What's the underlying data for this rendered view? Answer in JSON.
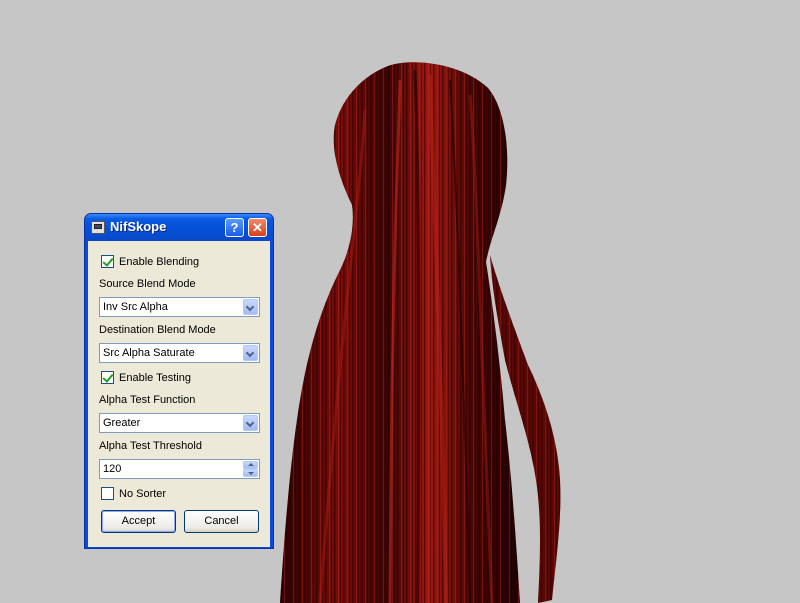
{
  "window": {
    "title": "NifSkope"
  },
  "titlebar": {
    "help_label": "?",
    "close_label": "✕"
  },
  "blending": {
    "enable_label": "Enable Blending",
    "enable_checked": true,
    "source_label": "Source Blend Mode",
    "source_value": "Inv Src Alpha",
    "dest_label": "Destination Blend Mode",
    "dest_value": "Src Alpha Saturate"
  },
  "testing": {
    "enable_label": "Enable Testing",
    "enable_checked": true,
    "function_label": "Alpha Test Function",
    "function_value": "Greater",
    "threshold_label": "Alpha Test Threshold",
    "threshold_value": "120"
  },
  "sorter": {
    "label": "No Sorter",
    "checked": false
  },
  "buttons": {
    "accept": "Accept",
    "cancel": "Cancel"
  },
  "colors": {
    "viewport_bg": "#c6c6c6",
    "hair_dark": "#2a0202",
    "hair_mid": "#7a0c08",
    "hair_light": "#b2221a",
    "dialog_face": "#ece9d8",
    "titlebar_blue": "#0a5ae0"
  }
}
